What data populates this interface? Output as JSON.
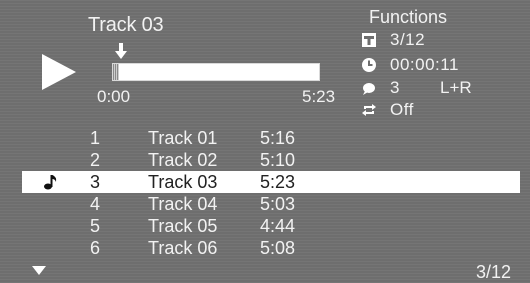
{
  "player": {
    "state": "playing",
    "track_title": "Track 03",
    "time_start": "0:00",
    "time_end": "5:23",
    "progress": 0.03
  },
  "functions": {
    "title": "Functions",
    "title_number": "3/12",
    "elapsed_time": "00:00:11",
    "audio_track": "3",
    "audio_channel": "L+R",
    "repeat": "Off"
  },
  "tracks": [
    {
      "number": "1",
      "name": "Track 01",
      "length": "5:16",
      "selected": false
    },
    {
      "number": "2",
      "name": "Track 02",
      "length": "5:10",
      "selected": false
    },
    {
      "number": "3",
      "name": "Track 03",
      "length": "5:23",
      "selected": true
    },
    {
      "number": "4",
      "name": "Track 04",
      "length": "5:03",
      "selected": false
    },
    {
      "number": "5",
      "name": "Track 05",
      "length": "4:44",
      "selected": false
    },
    {
      "number": "6",
      "name": "Track 06",
      "length": "5:08",
      "selected": false
    }
  ],
  "pagination": {
    "label": "3/12"
  },
  "icons": {
    "play": "play-icon",
    "position_marker": "down-arrow-icon",
    "title": "title-icon",
    "clock": "clock-icon",
    "audio": "audio-icon",
    "repeat": "repeat-icon",
    "now_playing": "music-note-icon",
    "scroll": "scroll-down-icon"
  },
  "colors": {
    "background": "#6e6e6e",
    "text": "#f2f2f2",
    "highlight": "#ffffff"
  }
}
